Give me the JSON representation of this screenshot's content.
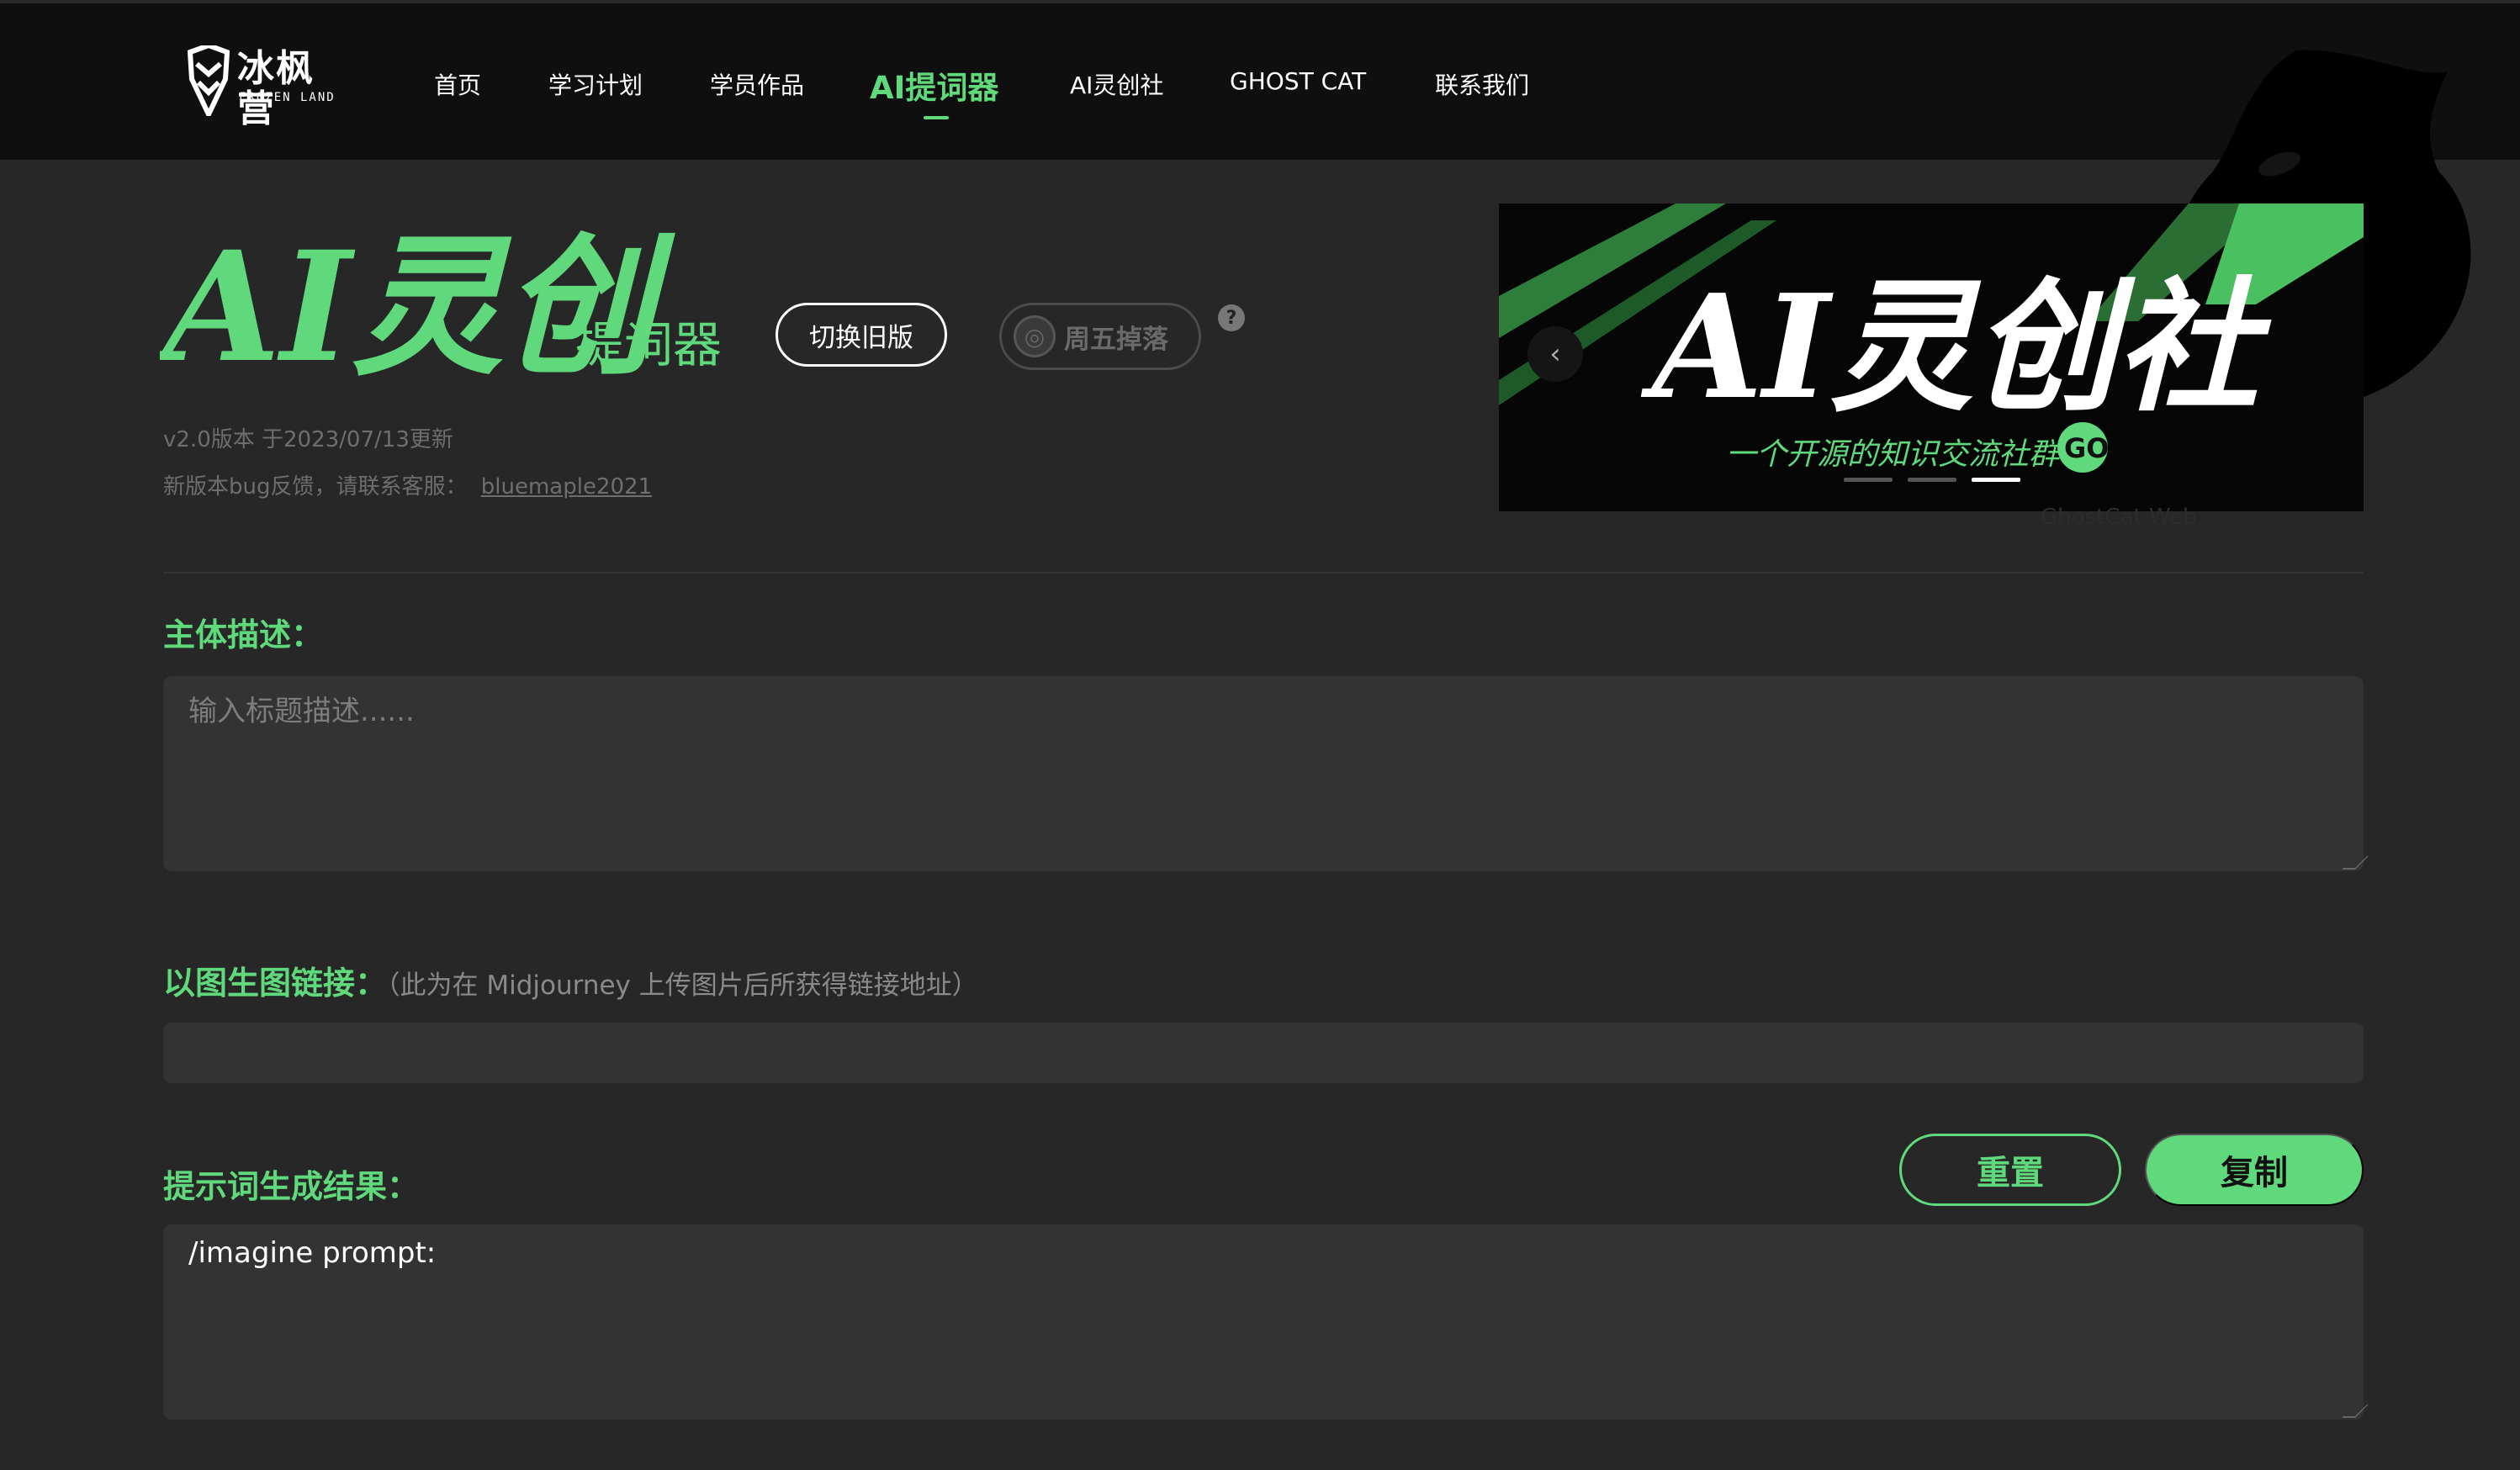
{
  "header": {
    "logo_text": "冰枫营",
    "logo_sub": "FROZEN LAND",
    "nav": [
      {
        "label": "首页",
        "active": false
      },
      {
        "label": "学习计划",
        "active": false
      },
      {
        "label": "学员作品",
        "active": false
      },
      {
        "label": "AI提词器",
        "active": true
      },
      {
        "label": "AI灵创社",
        "active": false
      },
      {
        "label": "GHOST CAT",
        "active": false
      },
      {
        "label": "联系我们",
        "active": false
      }
    ]
  },
  "hero": {
    "title_art": "AI灵创",
    "subtitle": "提词器",
    "switch_label": "切换旧版",
    "drop_label": "周五掉落",
    "help_symbol": "?",
    "version": "v2.0版本 于2023/07/13更新",
    "feedback_text": "新版本bug反馈，请联系客服：",
    "feedback_link": "bluemaple2021"
  },
  "banner": {
    "title_art": "AI灵创社",
    "tagline": "一个开源的知识交流社群！",
    "go_label": "GO",
    "prev_symbol": "‹",
    "slides": 3,
    "active_slide": 3,
    "caption": "GhostCat Web"
  },
  "form": {
    "subject_label": "主体描述：",
    "subject_placeholder": "输入标题描述......",
    "subject_value": "",
    "image_link_label": "以图生图链接：",
    "image_link_note": "（此为在 Midjourney 上传图片后所获得链接地址）",
    "image_link_value": "",
    "result_label": "提示词生成结果：",
    "result_value": "/imagine prompt:",
    "reset_label": "重置",
    "copy_label": "复制"
  },
  "colors": {
    "accent": "#5fd97b",
    "background": "#272727",
    "header_bg": "#0f0f0f",
    "field_bg": "#333333"
  }
}
